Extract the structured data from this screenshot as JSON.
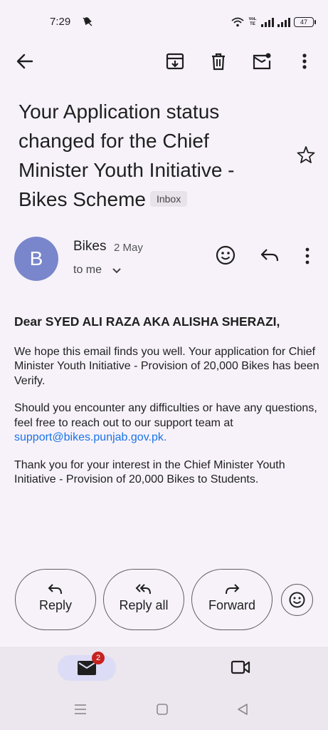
{
  "status_bar": {
    "time": "7:29",
    "network": "VoLTE",
    "battery": "47"
  },
  "toolbar": {
    "back": "back-arrow-icon",
    "archive": "archive-icon",
    "delete": "delete-icon",
    "mark_unread": "mark-unread-icon",
    "more": "more-vertical-icon"
  },
  "email": {
    "subject_line1": "Your Application status",
    "subject_line2": "changed for the Chief",
    "subject_line3": "Minister Youth Initiative -",
    "subject_line4": "Bikes Scheme",
    "label": "Inbox",
    "sender_initial": "B",
    "sender": "Bikes",
    "date": "2 May",
    "recipient": "to me",
    "greeting": "Dear SYED ALI RAZA AKA ALISHA SHERAZI,",
    "para1": "We hope this email finds you well. Your application for Chief Minister Youth Initiative - Provision of 20,000 Bikes has been Verify.",
    "para2_text": "Should you encounter any difficulties or have any questions, feel free to reach out to our support team at",
    "para2_link": "support@bikes.punjab.gov.pk.",
    "para3": "Thank you for your interest in the Chief Minister Youth Initiative - Provision of 20,000 Bikes to Students."
  },
  "actions": {
    "reply": "Reply",
    "reply_all": "Reply all",
    "forward": "Forward"
  },
  "bottom_nav": {
    "mail_badge": "2"
  },
  "colors": {
    "background": "#f7f2fa",
    "avatar": "#7986cb",
    "link": "#1a73e8",
    "badge": "#c5221f"
  }
}
